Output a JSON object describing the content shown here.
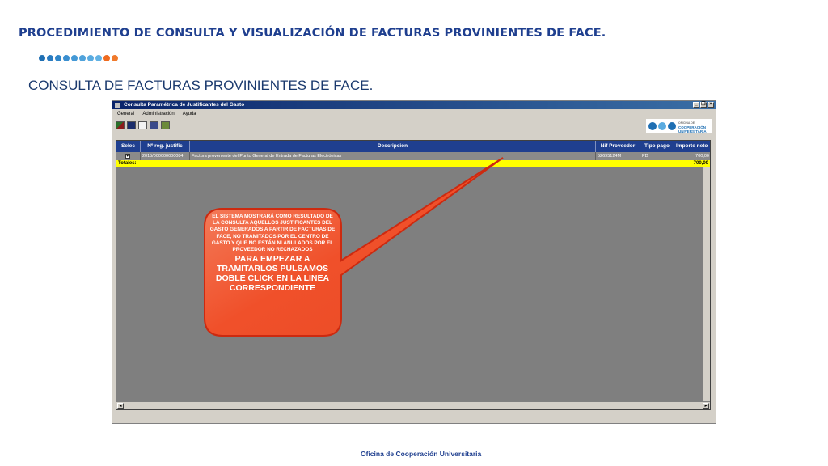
{
  "slide": {
    "title": "PROCEDIMIENTO DE CONSULTA Y VISUALIZACIÓN DE FACTURAS PROVINIENTES DE FACE.",
    "subtitle": "CONSULTA DE FACTURAS PROVINIENTES DE FACE.",
    "footer": "Oficina de Cooperación Universitaria",
    "dot_colors": [
      "#1f6fb3",
      "#2a7bc0",
      "#2f85c8",
      "#3a8fd0",
      "#4499d6",
      "#4fa2db",
      "#5aabe0",
      "#62b2e4",
      "#ef6b1f",
      "#f07a2c"
    ]
  },
  "window": {
    "title": "Consulta Paramétrica de Justificantes del Gasto",
    "controls": [
      "_",
      "❐",
      "×"
    ],
    "menu": [
      "General",
      "Administración",
      "Ayuda"
    ],
    "logo_text": [
      "OFICINA DE",
      "COOPERACIÓN",
      "UNIVERSITARIA"
    ]
  },
  "table": {
    "columns": [
      "Selec",
      "Nº reg. justific",
      "Descripción",
      "Nif Proveedor",
      "Tipo pago",
      "Importe neto"
    ],
    "rows": [
      {
        "selected": "✔",
        "reg": "2015/000000000084",
        "descripcion": "Factura proveniente del Punto General de Entrada de Facturas Electrónicas",
        "nif": "52695124M",
        "tipo_pago": "PD",
        "importe": "700,00"
      }
    ],
    "totals_label": "Totales:",
    "totals_value": "700,00",
    "scroll_left": "◂",
    "scroll_right": "▸"
  },
  "callout": {
    "small_text": "EL SISTEMA MOSTRARÁ COMO RESULTADO DE LA CONSULTA AQUELLOS JUSTIFICANTES DEL GASTO GENERADOS A PARTIR DE FACTURAS DE FACE, NO TRAMITADOS POR EL CENTRO DE GASTO Y QUE NO ESTÁN NI ANULADOS POR EL PROVEEDOR NO RECHAZADOS",
    "big_text": "PARA EMPEZAR A TRAMITARLOS PULSAMOS DOBLE CLICK EN LA LINEA CORRESPONDIENTE",
    "fill_color": "#f0502a",
    "border_color": "#cc2a10"
  }
}
